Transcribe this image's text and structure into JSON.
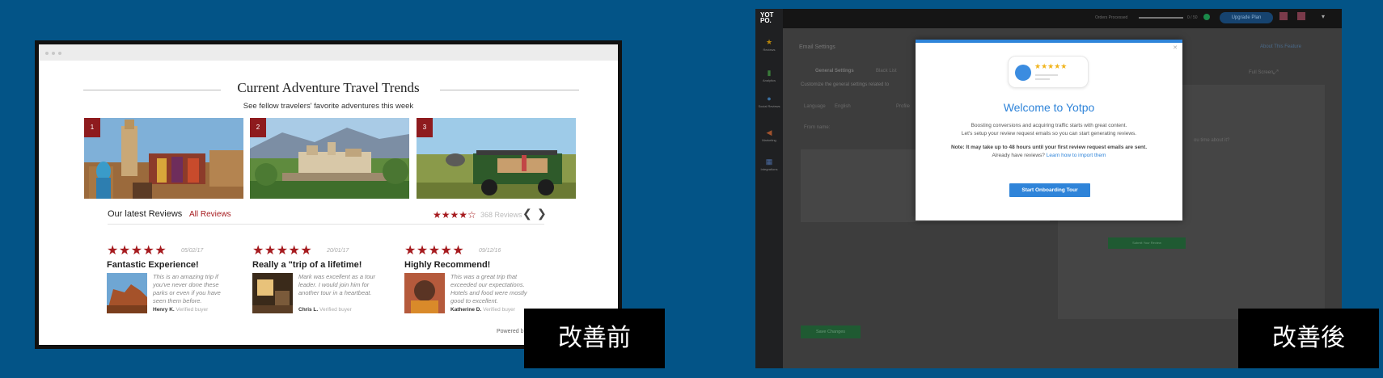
{
  "left_panel": {
    "section_title": "Current Adventure Travel Trends",
    "section_subtitle": "See fellow travelers' favorite adventures this week",
    "photos": [
      {
        "rank": "1",
        "subject": "moroccan-market"
      },
      {
        "rank": "2",
        "subject": "italian-hill-town"
      },
      {
        "rank": "3",
        "subject": "safari-jeep"
      }
    ],
    "reviews_heading": "Our latest Reviews",
    "all_reviews_link": "All Reviews",
    "summary_stars": "★★★★☆",
    "summary_count": "368 Reviews",
    "prev_arrow": "❮",
    "next_arrow": "❯",
    "reviews": [
      {
        "stars": "★★★★★",
        "date": "05/02/17",
        "title": "Fantastic Experience!",
        "body": "This is an amazing trip if you've never done these parks or even if you have seen them before.",
        "author": "Henry K.",
        "badge": "Verified buyer"
      },
      {
        "stars": "★★★★★",
        "date": "20/01/17",
        "title": "Really a \"trip of a lifetime!",
        "body": "Mark was excellent as a tour leader. I would join him for another tour in a heartbeat.",
        "author": "Chris L.",
        "badge": "Verified buyer"
      },
      {
        "stars": "★★★★★",
        "date": "09/12/16",
        "title": "Highly Recommend!",
        "body": "This was a great trip that exceeded our expectations. Hotels and food were mostly good to excellent.",
        "author": "Katherine D.",
        "badge": "Verified buyer"
      }
    ],
    "powered_by": "Powered b",
    "caption": "改善前"
  },
  "right_panel": {
    "logo": "YOT PO.",
    "orders_label": "Orders Processed",
    "orders_count": "0 / 50",
    "upgrade_label": "Upgrade Plan",
    "sidebar": [
      {
        "icon": "star-icon",
        "label": "Reviews"
      },
      {
        "icon": "bar-chart-icon",
        "label": "Analytics"
      },
      {
        "icon": "chat-icon",
        "label": "Social Reviews"
      },
      {
        "icon": "megaphone-icon",
        "label": "Marketing"
      },
      {
        "icon": "grid-icon",
        "label": "Integrations"
      }
    ],
    "page_title": "Email Settings",
    "about_link": "About This Feature",
    "tabs": [
      "General Settings",
      "Black List"
    ],
    "customize_text": "Customize the general settings related to",
    "language_label": "Language",
    "language_value": "English",
    "profile_label": "Profile",
    "from_name_label": "From name:",
    "full_screen_label": "Full Screen",
    "time_question": "ou time about it?",
    "submit_label": "Submit Your Review",
    "save_label": "Save Changes",
    "modal": {
      "card_stars": "★★★★★",
      "title": "Welcome to Yotpo",
      "body_line1": "Boosting conversions and acquiring traffic starts with great content.",
      "body_line2": "Let's setup your review request emails so you can start generating reviews.",
      "note": "Note: It may take up to 48 hours until your first review request emails are sent.",
      "already": "Already have reviews?",
      "import_link": "Learn how to import them",
      "cta": "Start Onboarding Tour"
    },
    "caption": "改善後"
  },
  "colors": {
    "background": "#035487",
    "brand_red": "#a61b1f",
    "yotpo_blue": "#2f84d9",
    "save_green": "#1f7a3a"
  }
}
